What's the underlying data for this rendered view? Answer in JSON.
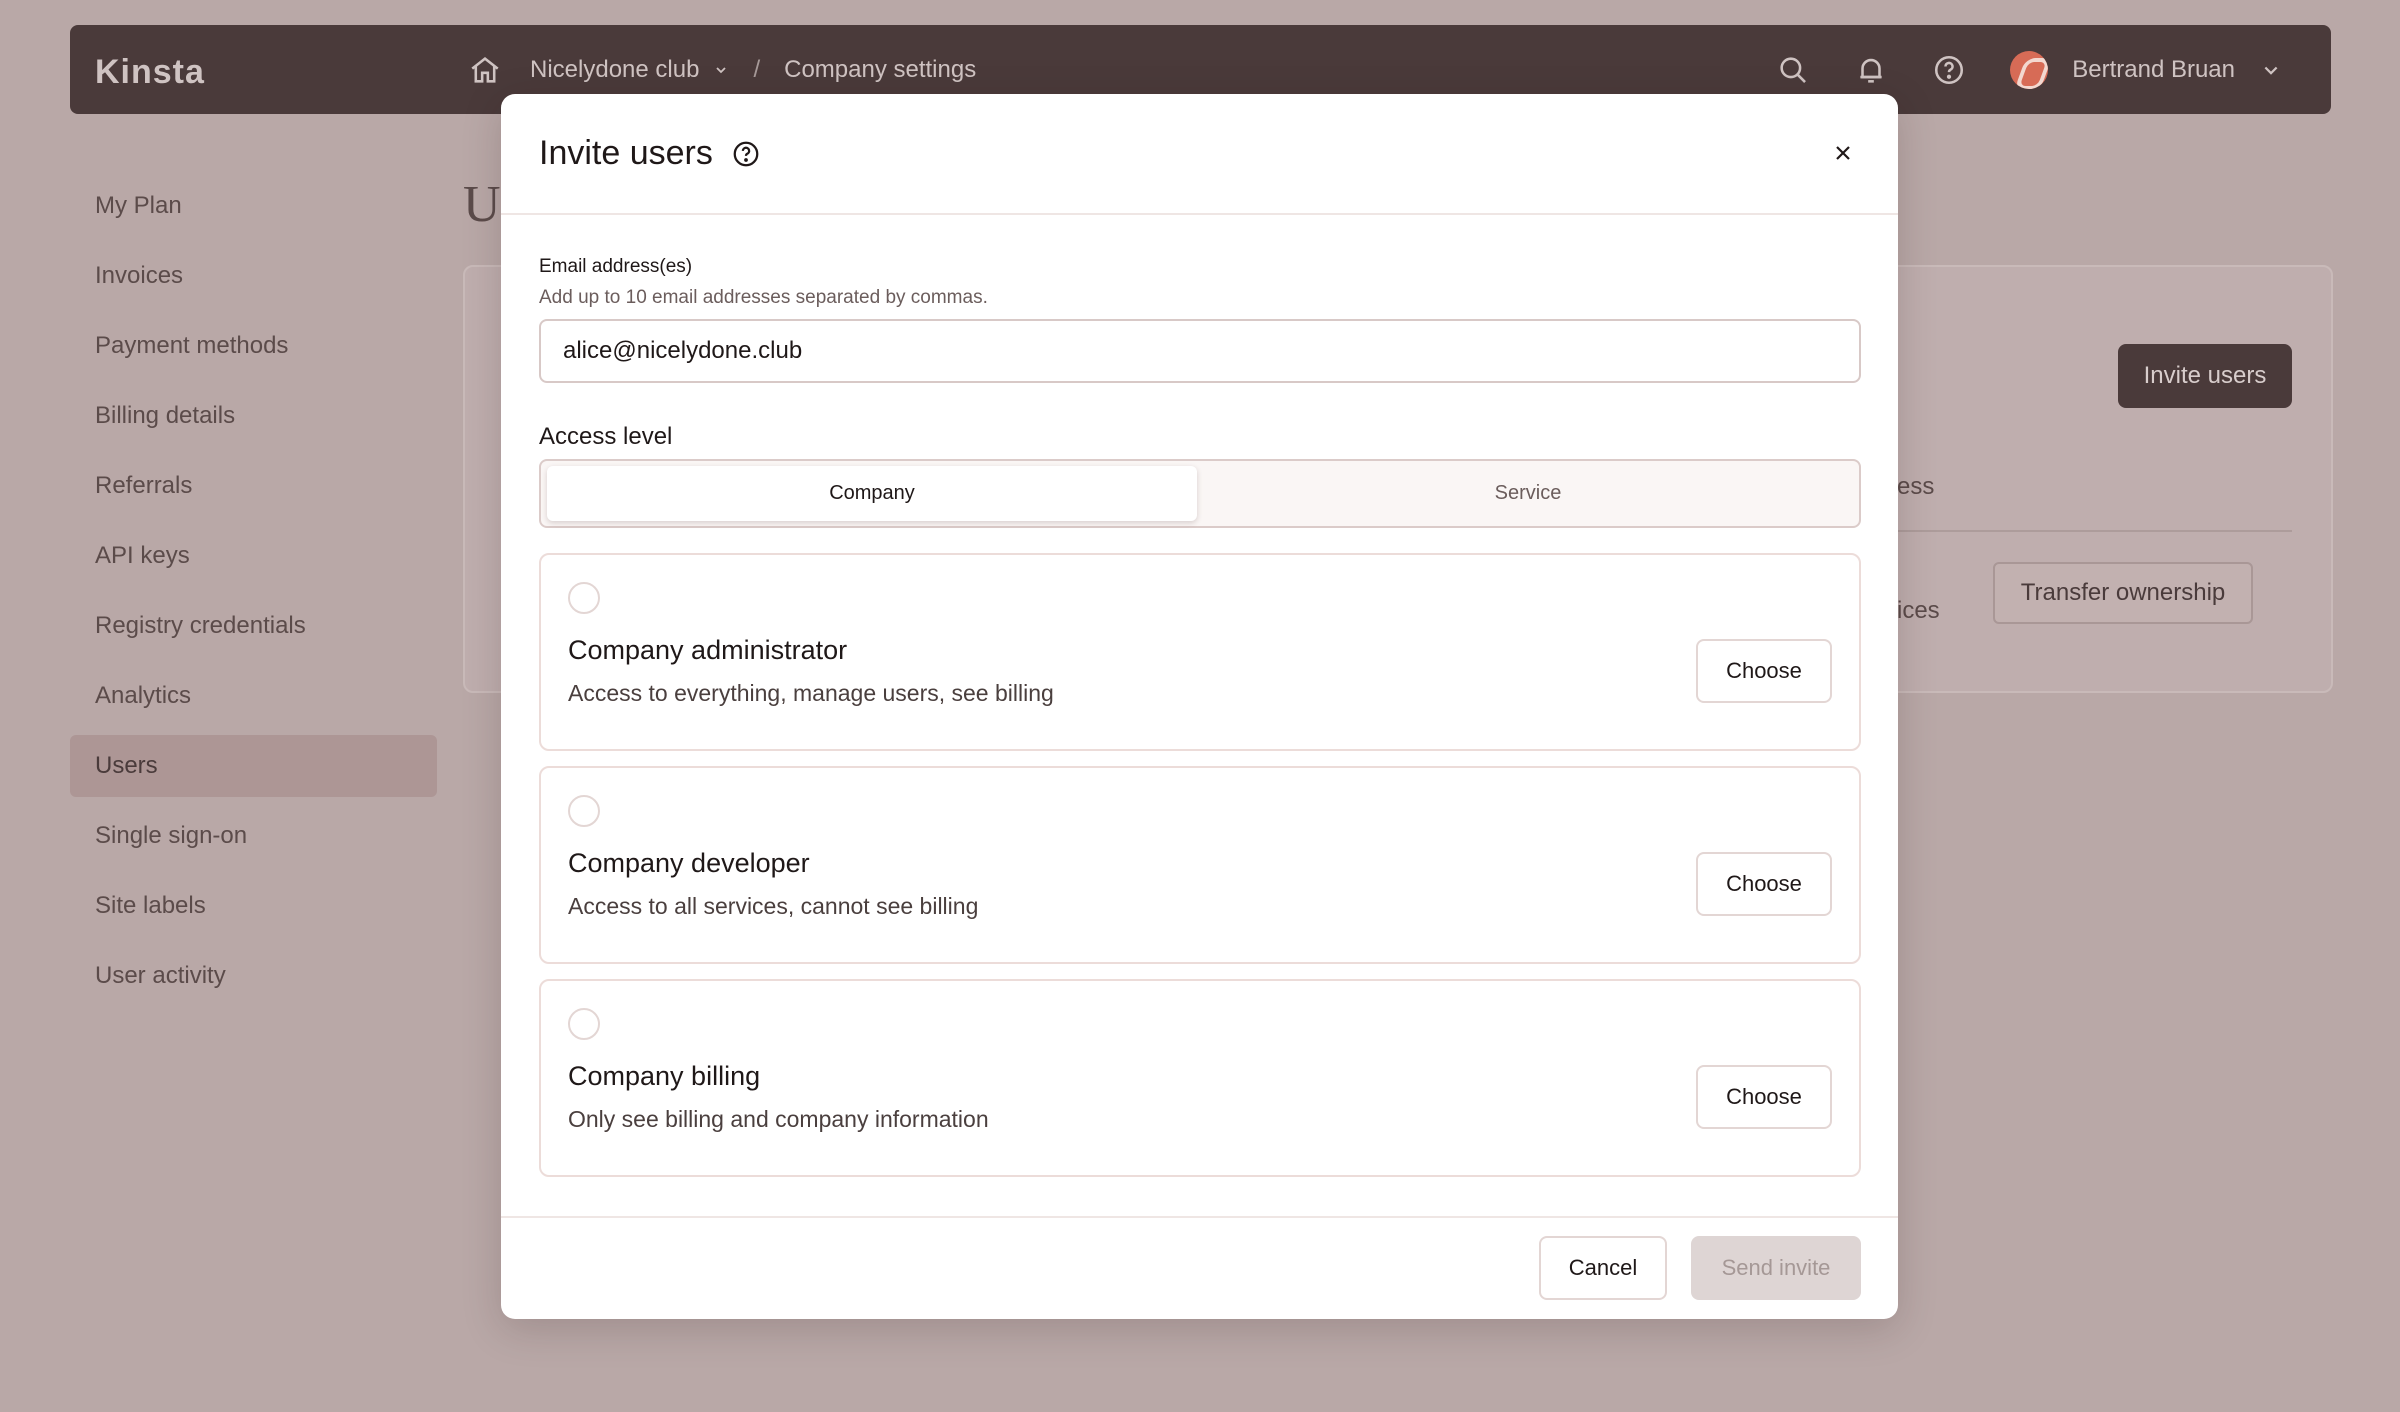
{
  "topbar": {
    "logo": "Kinsta",
    "breadcrumb_company": "Nicelydone club",
    "breadcrumb_separator": "/",
    "breadcrumb_page": "Company settings",
    "user_name": "Bertrand Bruan"
  },
  "sidebar": {
    "items": [
      {
        "label": "My Plan"
      },
      {
        "label": "Invoices"
      },
      {
        "label": "Payment methods"
      },
      {
        "label": "Billing details"
      },
      {
        "label": "Referrals"
      },
      {
        "label": "API keys"
      },
      {
        "label": "Registry credentials"
      },
      {
        "label": "Analytics"
      },
      {
        "label": "Users",
        "active": true
      },
      {
        "label": "Single sign-on"
      },
      {
        "label": "Site labels"
      },
      {
        "label": "User activity"
      }
    ]
  },
  "background": {
    "page_title_partial": "U",
    "invite_button": "Invite users",
    "access_header_partial": "ess",
    "services_partial": "ices",
    "transfer_button": "Transfer ownership"
  },
  "modal": {
    "title": "Invite users",
    "email_label": "Email address(es)",
    "email_help": "Add up to 10 email addresses separated by commas.",
    "email_value": "alice@nicelydone.club",
    "access_label": "Access level",
    "tabs": [
      {
        "label": "Company",
        "selected": true
      },
      {
        "label": "Service",
        "selected": false
      }
    ],
    "roles": [
      {
        "title": "Company administrator",
        "description": "Access to everything, manage users, see billing",
        "action": "Choose"
      },
      {
        "title": "Company developer",
        "description": "Access to all services, cannot see billing",
        "action": "Choose"
      },
      {
        "title": "Company billing",
        "description": "Only see billing and company information",
        "action": "Choose"
      }
    ],
    "cancel_label": "Cancel",
    "send_label": "Send invite"
  },
  "colors": {
    "backdrop": "#b9a8a7",
    "topbar": "#4a3a3a",
    "accent_dark": "#4a3a3a",
    "disabled_button": "#ded5d4"
  }
}
